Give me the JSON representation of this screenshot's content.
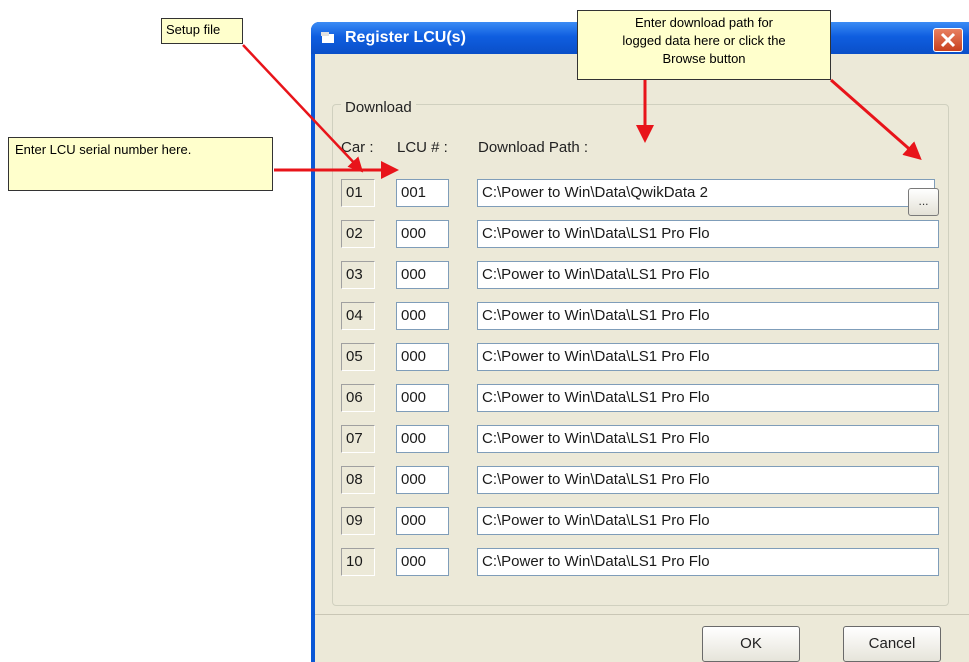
{
  "dialog": {
    "title": "Register LCU(s)",
    "group_label": "Download",
    "headers": {
      "car": "Car :",
      "lcu": "LCU # :",
      "path": "Download Path :"
    },
    "rows": [
      {
        "car": "01",
        "lcu": "001",
        "path": "C:\\Power to Win\\Data\\QwikData 2"
      },
      {
        "car": "02",
        "lcu": "000",
        "path": "C:\\Power to Win\\Data\\LS1 Pro Flo"
      },
      {
        "car": "03",
        "lcu": "000",
        "path": "C:\\Power to Win\\Data\\LS1 Pro Flo"
      },
      {
        "car": "04",
        "lcu": "000",
        "path": "C:\\Power to Win\\Data\\LS1 Pro Flo"
      },
      {
        "car": "05",
        "lcu": "000",
        "path": "C:\\Power to Win\\Data\\LS1 Pro Flo"
      },
      {
        "car": "06",
        "lcu": "000",
        "path": "C:\\Power to Win\\Data\\LS1 Pro Flo"
      },
      {
        "car": "07",
        "lcu": "000",
        "path": "C:\\Power to Win\\Data\\LS1 Pro Flo"
      },
      {
        "car": "08",
        "lcu": "000",
        "path": "C:\\Power to Win\\Data\\LS1 Pro Flo"
      },
      {
        "car": "09",
        "lcu": "000",
        "path": "C:\\Power to Win\\Data\\LS1 Pro Flo"
      },
      {
        "car": "10",
        "lcu": "000",
        "path": "C:\\Power to Win\\Data\\LS1 Pro Flo"
      }
    ],
    "browse_label": "...",
    "ok_label": "OK",
    "cancel_label": "Cancel"
  },
  "callouts": {
    "setup_file": "Setup file",
    "serial": "Enter LCU serial number here.",
    "path_line1": "Enter download path for",
    "path_line2": "logged data here or click the",
    "path_line3": "Browse button"
  },
  "colors": {
    "title_bar": "#0a57d6",
    "dialog_bg": "#ece9d8",
    "callout_bg": "#ffffcc",
    "arrow": "#e8141a",
    "close_button": "#d1502c"
  },
  "icons": [
    "app-icon",
    "close-icon",
    "arrow"
  ]
}
